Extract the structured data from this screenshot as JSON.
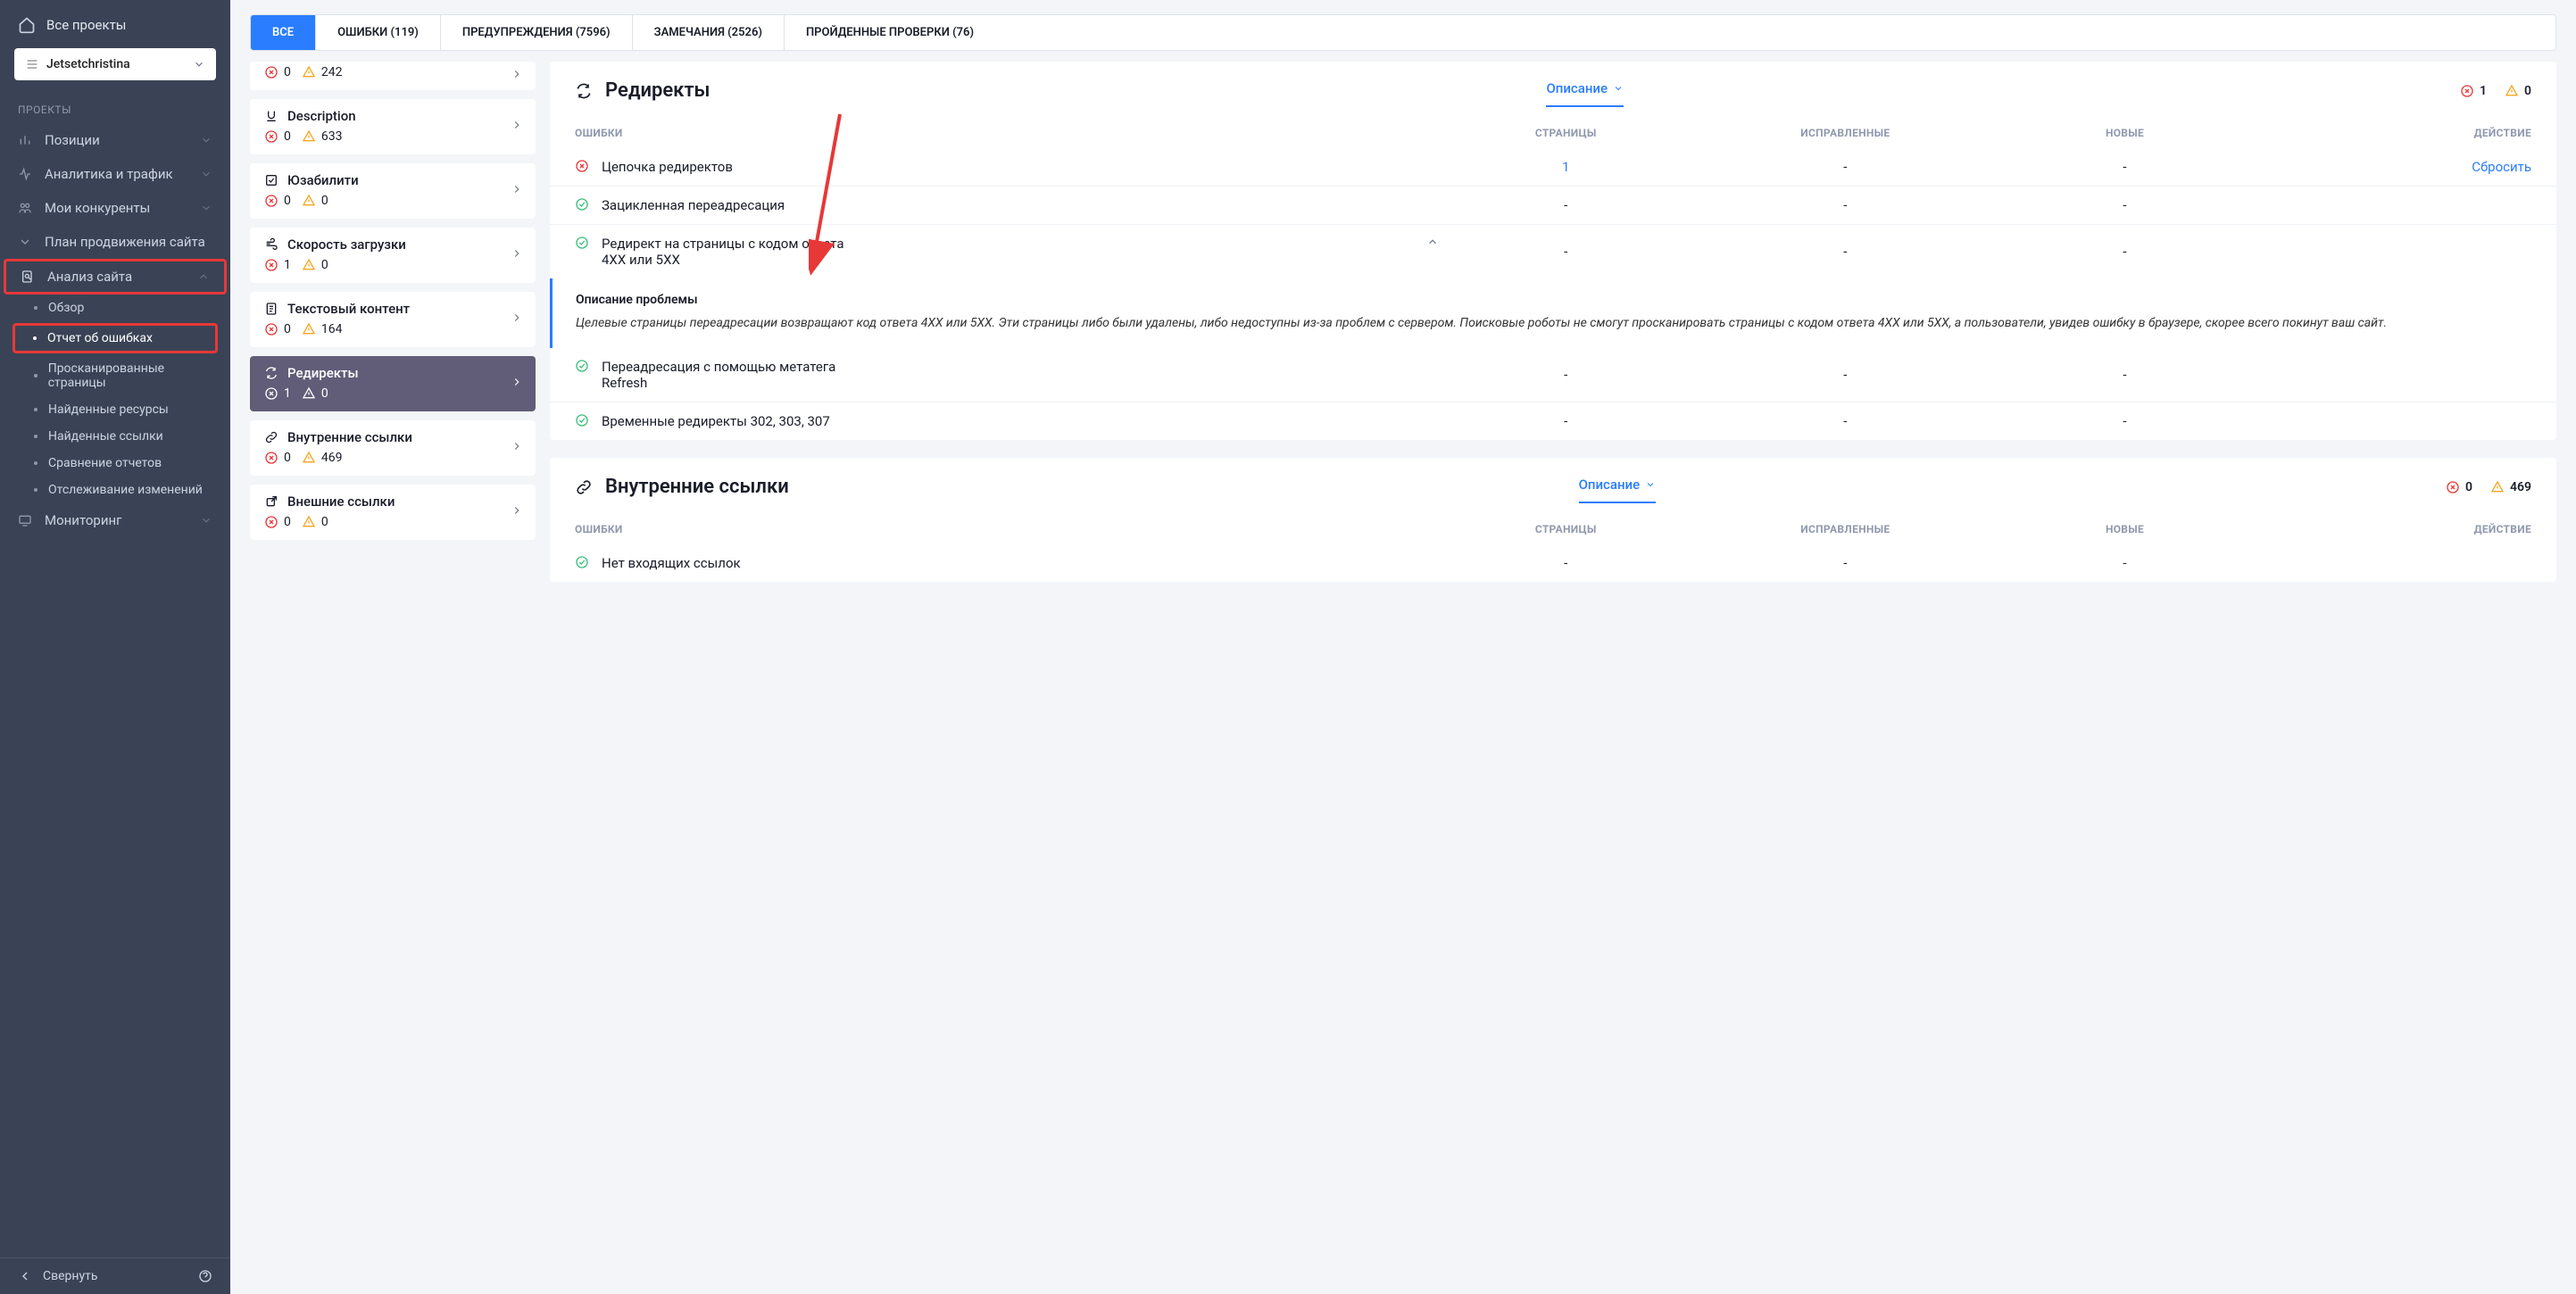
{
  "sidebar": {
    "all_projects": "Все проекты",
    "project_name": "Jetsetchristina",
    "section_projects": "ПРОЕКТЫ",
    "items": [
      {
        "label": "Позиции"
      },
      {
        "label": "Аналитика и трафик"
      },
      {
        "label": "Мои конкуренты"
      },
      {
        "label": "План продвижения сайта"
      },
      {
        "label": "Анализ сайта"
      }
    ],
    "sub": [
      {
        "label": "Обзор"
      },
      {
        "label": "Отчет об ошибках"
      },
      {
        "label": "Просканированные страницы"
      },
      {
        "label": "Найденные ресурсы"
      },
      {
        "label": "Найденные ссылки"
      },
      {
        "label": "Сравнение отчетов"
      },
      {
        "label": "Отслеживание изменений"
      }
    ],
    "monitoring": "Мониторинг",
    "collapse": "Свернуть"
  },
  "tabs": {
    "all": "ВСЕ",
    "errors": "ОШИБКИ (119)",
    "warnings": "ПРЕДУПРЕЖДЕНИЯ (7596)",
    "notes": "ЗАМЕЧАНИЯ (2526)",
    "passed": "ПРОЙДЕННЫЕ ПРОВЕРКИ (76)"
  },
  "mini": [
    {
      "title": "",
      "err": "0",
      "warn": "242"
    },
    {
      "title": "Description",
      "err": "0",
      "warn": "633"
    },
    {
      "title": "Юзабилити",
      "err": "0",
      "warn": "0"
    },
    {
      "title": "Скорость загрузки",
      "err": "1",
      "warn": "0"
    },
    {
      "title": "Текстовый контент",
      "err": "0",
      "warn": "164"
    },
    {
      "title": "Редиректы",
      "err": "1",
      "warn": "0"
    },
    {
      "title": "Внутренние ссылки",
      "err": "0",
      "warn": "469"
    },
    {
      "title": "Внешние ссылки",
      "err": "0",
      "warn": "0"
    }
  ],
  "panels": {
    "redirects": {
      "title": "Редиректы",
      "desc_toggle": "Описание",
      "badge_err": "1",
      "badge_warn": "0",
      "thead": {
        "c1": "ОШИБКИ",
        "c2": "СТРАНИЦЫ",
        "c3": "ИСПРАВЛЕННЫЕ",
        "c4": "НОВЫЕ",
        "c5": "ДЕЙСТВИЕ"
      },
      "rows": [
        {
          "icon": "err",
          "name": "Цепочка редиректов",
          "pages": "1",
          "fixed": "-",
          "new": "-",
          "action": "Сбросить"
        },
        {
          "icon": "ok",
          "name": "Зацикленная переадресация",
          "pages": "-",
          "fixed": "-",
          "new": "-",
          "action": ""
        },
        {
          "icon": "ok",
          "name": "Редирект на страницы с кодом ответа 4XX или 5XX",
          "pages": "-",
          "fixed": "-",
          "new": "-",
          "action": "",
          "expanded": true
        },
        {
          "icon": "ok",
          "name": "Переадресация с помощью метатега Refresh",
          "pages": "-",
          "fixed": "-",
          "new": "-",
          "action": ""
        },
        {
          "icon": "ok",
          "name": "Временные редиректы 302, 303, 307",
          "pages": "-",
          "fixed": "-",
          "new": "-",
          "action": ""
        }
      ],
      "expand_title": "Описание проблемы",
      "expand_text": "Целевые страницы переадресации возвращают код ответа 4XX или 5XX. Эти страницы либо были удалены, либо недоступны из-за проблем с сервером. Поисковые роботы не смогут просканировать страницы с кодом ответа 4XX или 5XX, а пользователи, увидев ошибку в браузере, скорее всего покинут ваш сайт."
    },
    "internal": {
      "title": "Внутренние ссылки",
      "desc_toggle": "Описание",
      "badge_err": "0",
      "badge_warn": "469",
      "thead": {
        "c1": "ОШИБКИ",
        "c2": "СТРАНИЦЫ",
        "c3": "ИСПРАВЛЕННЫЕ",
        "c4": "НОВЫЕ",
        "c5": "ДЕЙСТВИЕ"
      },
      "row0_name": "Нет входящих ссылок",
      "dash": "-"
    }
  }
}
